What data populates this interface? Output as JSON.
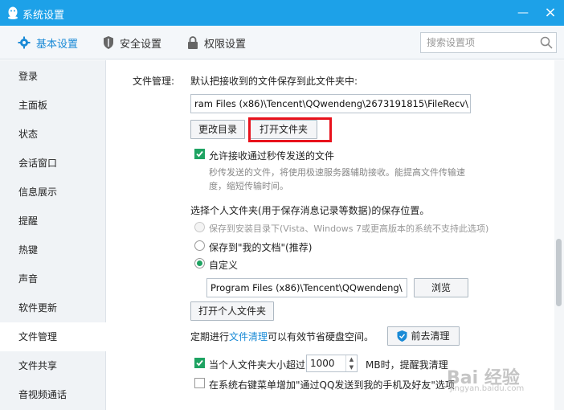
{
  "window": {
    "title": "系统设置"
  },
  "tabs": [
    {
      "label": "基本设置",
      "icon": "gear-icon",
      "active": true
    },
    {
      "label": "安全设置",
      "icon": "shield-icon",
      "active": false
    },
    {
      "label": "权限设置",
      "icon": "lock-icon",
      "active": false
    }
  ],
  "search": {
    "placeholder": "搜索设置项"
  },
  "sidebar": {
    "items": [
      "登录",
      "主面板",
      "状态",
      "会话窗口",
      "信息展示",
      "提醒",
      "热键",
      "声音",
      "软件更新",
      "文件管理",
      "文件共享",
      "音视频通话"
    ],
    "active_index": 9
  },
  "file_mgmt": {
    "section_label": "文件管理:",
    "default_save_text": "默认把接收到的文件保存到此文件夹中:",
    "recv_path": "ram Files (x86)\\Tencent\\QQwendeng\\2673191815\\FileRecv\\",
    "change_dir_button": "更改目录",
    "open_folder_button": "打开文件夹",
    "allow_transfer": {
      "label": "允许接收通过秒传发送的文件",
      "checked": true
    },
    "transfer_desc_1": "秒传发送的文件，将使用极速服务器辅助接收。能提高文件传输速",
    "transfer_desc_2": "度，缩短传输时间。",
    "personal_folder_title": "选择个人文件夹(用于保存消息记录等数据)的保存位置。",
    "radio_install": "保存到安装目录下(Vista、Windows 7或更高版本的系统不支持此选项)",
    "radio_mydocs": "保存到\"我的文档\"(推荐)",
    "radio_custom": "自定义",
    "custom_path": "Program Files (x86)\\Tencent\\QQwendeng\\",
    "browse_button": "浏览",
    "open_personal_button": "打开个人文件夹",
    "cleanup_prefix": "定期进行",
    "cleanup_link": "文件清理",
    "cleanup_suffix": "可以有效节省硬盘空间。",
    "cleanup_button": "前去清理",
    "size_limit": {
      "prefix": "当个人文件夹大小超过",
      "value": "1000",
      "suffix": "MB时，提醒我清理",
      "checked": true
    },
    "context_menu": {
      "label": "在系统右键菜单增加\"通过QQ发送到我的手机及好友\"选项",
      "checked": false
    }
  },
  "watermark": {
    "text": "Bai 经验",
    "sub": "jingyan.baidu.com"
  },
  "colors": {
    "title_bar": "#1da1e8",
    "accent": "#1a8ad6",
    "check_green": "#1ea362",
    "highlight_red": "#e8121c"
  }
}
